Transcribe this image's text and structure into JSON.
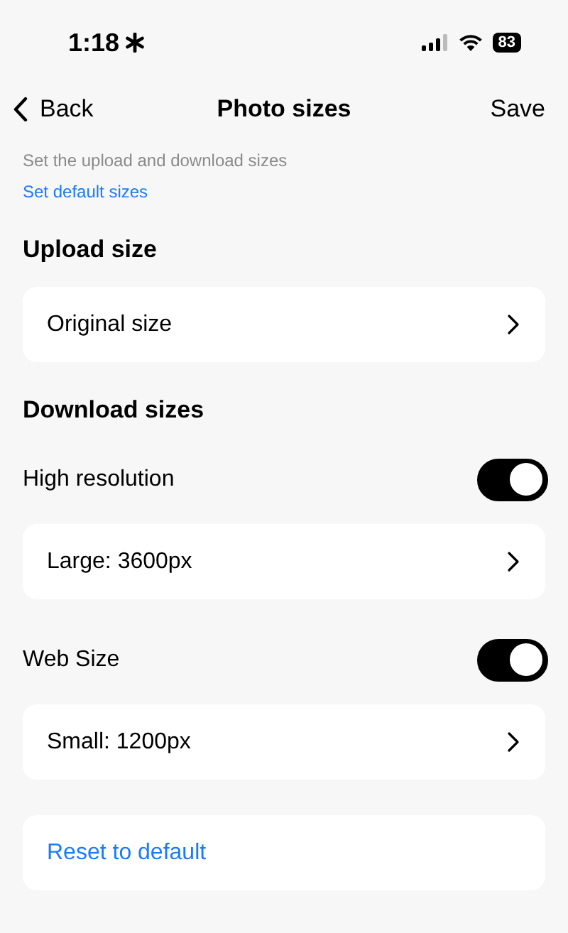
{
  "status_bar": {
    "time": "1:18",
    "battery": "83"
  },
  "nav": {
    "back": "Back",
    "title": "Photo sizes",
    "action": "Save"
  },
  "intro": {
    "description": "Set the upload and download sizes",
    "link": "Set default sizes"
  },
  "sections": [
    {
      "heading": "Upload size",
      "items": [
        {
          "kind": "link_row",
          "label": "Original size"
        }
      ]
    },
    {
      "heading": "Download sizes",
      "items": [
        {
          "kind": "toggle",
          "label": "High resolution",
          "on": true
        },
        {
          "kind": "link_row",
          "label": "Large: 3600px"
        },
        {
          "kind": "toggle",
          "label": "Web Size",
          "on": true
        },
        {
          "kind": "link_row",
          "label": "Small: 1200px"
        }
      ]
    }
  ],
  "reset": "Reset to default"
}
